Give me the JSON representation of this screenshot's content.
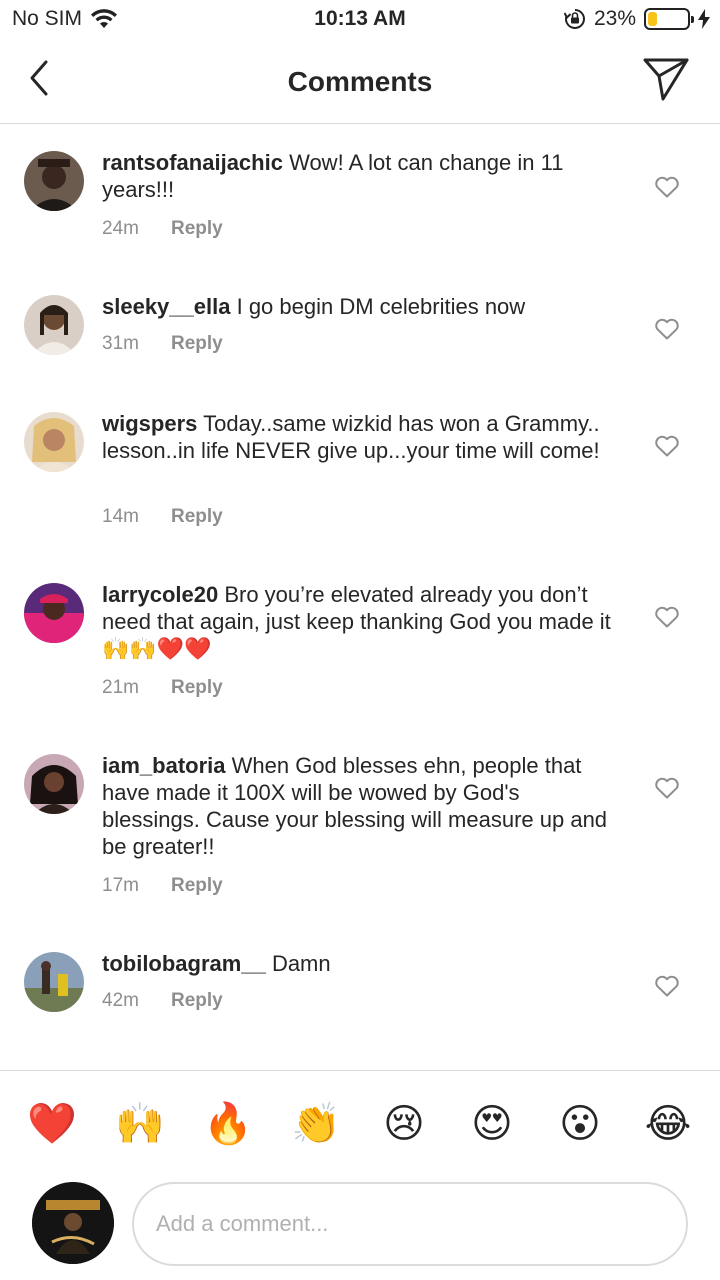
{
  "status_bar": {
    "carrier": "No SIM",
    "time": "10:13 AM",
    "battery_percent": "23%",
    "battery_level": 0.23,
    "battery_color": "#f5c518"
  },
  "nav": {
    "title": "Comments",
    "back_icon": "chevron-left-icon",
    "send_icon": "paper-plane-icon"
  },
  "comments": [
    {
      "username": "rantsofanaijachic",
      "text": "Wow! A lot can change in 11 years!!!",
      "time": "24m",
      "reply_label": "Reply"
    },
    {
      "username": "sleeky__ella",
      "text": "I go begin DM celebrities now",
      "time": "31m",
      "reply_label": "Reply"
    },
    {
      "username": "wigspers",
      "text": "Today..same wizkid has won a Grammy.. lesson..in life NEVER give up...your time will come!",
      "time": "14m",
      "reply_label": "Reply"
    },
    {
      "username": "larrycole20",
      "text": "Bro you’re elevated already you don’t need that again, just keep thanking God you made it 🙌🙌❤️❤️",
      "time": "21m",
      "reply_label": "Reply"
    },
    {
      "username": "iam_batoria",
      "text": "When  God blesses ehn, people that have made it 100X will be wowed by God's blessings. Cause your blessing will measure up and be greater!!",
      "time": "17m",
      "reply_label": "Reply"
    },
    {
      "username": "tobilobagram__",
      "text": "Damn",
      "time": "42m",
      "reply_label": "Reply"
    }
  ],
  "emoji_bar": [
    "❤️",
    "🙌",
    "🔥",
    "👏",
    "😢",
    "😍",
    "😮",
    "😂"
  ],
  "composer": {
    "placeholder": "Add a comment..."
  }
}
